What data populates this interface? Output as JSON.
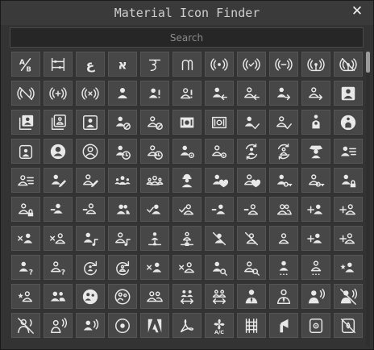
{
  "window": {
    "title": "Material Icon Finder",
    "close_glyph": "✕"
  },
  "search": {
    "placeholder": "Search",
    "value": ""
  },
  "icon_color": "#e8e8e8",
  "icons": [
    "ab-testing-icon",
    "abacus-icon",
    "abjad-arabic-icon",
    "abjad-hebrew-icon",
    "abugida-devanagari-icon",
    "abugida-thai-icon",
    "access-point-icon",
    "access-point-check-icon",
    "access-point-minus-icon",
    "access-point-network-icon",
    "access-point-network-off-icon",
    "access-point-off-icon",
    "access-point-plus-icon",
    "access-point-remove-icon",
    "account-icon",
    "account-alert-icon",
    "account-alert-outline-icon",
    "account-arrow-left-icon",
    "account-arrow-left-outline-icon",
    "account-arrow-right-icon",
    "account-arrow-right-outline-icon",
    "account-box-icon",
    "account-box-multiple-icon",
    "account-box-multiple-outline-icon",
    "account-box-outline-icon",
    "account-cancel-icon",
    "account-cancel-outline-icon",
    "account-cash-icon",
    "account-cash-outline-icon",
    "account-check-icon",
    "account-check-outline-icon",
    "account-child-icon",
    "account-child-circle-icon",
    "account-child-outline-icon",
    "account-circle-icon",
    "account-circle-outline-icon",
    "account-clock-icon",
    "account-clock-outline-icon",
    "account-cog-icon",
    "account-cog-outline-icon",
    "account-convert-icon",
    "account-convert-outline-icon",
    "account-cowboy-hat-icon",
    "account-details-icon",
    "account-details-outline-icon",
    "account-edit-icon",
    "account-edit-outline-icon",
    "account-group-icon",
    "account-group-outline-icon",
    "account-hard-hat-icon",
    "account-heart-icon",
    "account-heart-outline-icon",
    "account-key-icon",
    "account-key-outline-icon",
    "account-lock-icon",
    "account-lock-outline-icon",
    "account-minus-icon",
    "account-minus-outline-icon",
    "account-multiple-icon",
    "account-multiple-check-icon",
    "account-multiple-check-outline-icon",
    "account-multiple-minus-icon",
    "account-multiple-minus-outline-icon",
    "account-multiple-outline-icon",
    "account-multiple-plus-icon",
    "account-multiple-plus-outline-icon",
    "account-multiple-remove-icon",
    "account-multiple-remove-outline-icon",
    "account-music-icon",
    "account-music-outline-icon",
    "account-network-icon",
    "account-network-outline-icon",
    "account-off-icon",
    "account-off-outline-icon",
    "account-outline-icon",
    "account-plus-icon",
    "account-plus-outline-icon",
    "account-question-icon",
    "account-question-outline-icon",
    "account-reactivate-icon",
    "account-reactivate-outline-icon",
    "account-remove-icon",
    "account-remove-outline-icon",
    "account-search-icon",
    "account-search-outline-icon",
    "account-settings-icon",
    "account-settings-outline-icon",
    "account-star-icon",
    "account-star-outline-icon",
    "account-supervisor-icon",
    "account-supervisor-circle-icon",
    "account-supervisor-circle-outline-icon",
    "account-supervisor-outline-icon",
    "account-switch-icon",
    "account-switch-outline-icon",
    "account-tie-icon",
    "account-tie-outline-icon",
    "account-tie-voice-icon",
    "account-tie-voice-off-icon",
    "account-tie-voice-off-outline-icon",
    "account-tie-voice-outline-icon",
    "account-voice-icon",
    "adjust-icon",
    "adobe-icon",
    "adobe-acrobat-icon",
    "air-conditioner-icon",
    "air-filter-icon",
    "air-horn-icon",
    "air-humidifier-icon",
    "air-humidifier-off-icon"
  ]
}
